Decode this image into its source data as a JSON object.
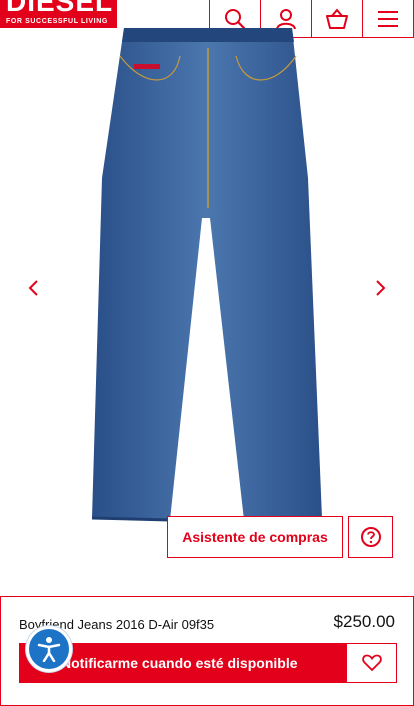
{
  "brand": {
    "name": "DIESEL",
    "tagline": "FOR SUCCESSFUL LIVING",
    "accent_color": "#e2001a"
  },
  "header": {
    "icons": [
      "search-icon",
      "account-icon",
      "basket-icon",
      "menu-icon"
    ]
  },
  "gallery": {
    "prev_icon": "chevron-left-icon",
    "next_icon": "chevron-right-icon"
  },
  "assistant": {
    "label": "Asistente de compras",
    "help_icon": "question-circle-icon"
  },
  "product": {
    "name": "Boyfriend Jeans 2016 D-Air 09f35",
    "price": "$250.00"
  },
  "actions": {
    "notify_label": "Notificarme cuando esté disponible",
    "wishlist_icon": "heart-icon"
  },
  "accessibility": {
    "icon": "accessibility-icon",
    "color": "#1d74c7"
  }
}
